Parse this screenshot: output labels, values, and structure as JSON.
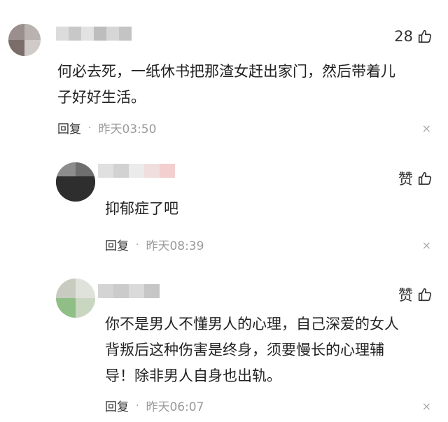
{
  "comments": [
    {
      "like": "28",
      "text": "何必去死，一纸休书把那渣女赶出家门，然后带着儿\n子好好生活。",
      "reply": "回复",
      "sep": "·",
      "time": "昨天03:50",
      "close": "×"
    },
    {
      "like": "赞",
      "text": "抑郁症了吧",
      "reply": "回复",
      "sep": "·",
      "time": "昨天08:39",
      "close": "×"
    },
    {
      "like": "赞",
      "text": "你不是男人不懂男人的心理，自己深爱的女人\n背叛后这种伤害是终身，须要慢长的心理辅\n导！除非男人自身也出轨。",
      "reply": "回复",
      "sep": "·",
      "time": "昨天06:07",
      "close": "×"
    }
  ],
  "icons": {
    "like": "thumbs-up-icon",
    "close": "close-icon"
  }
}
